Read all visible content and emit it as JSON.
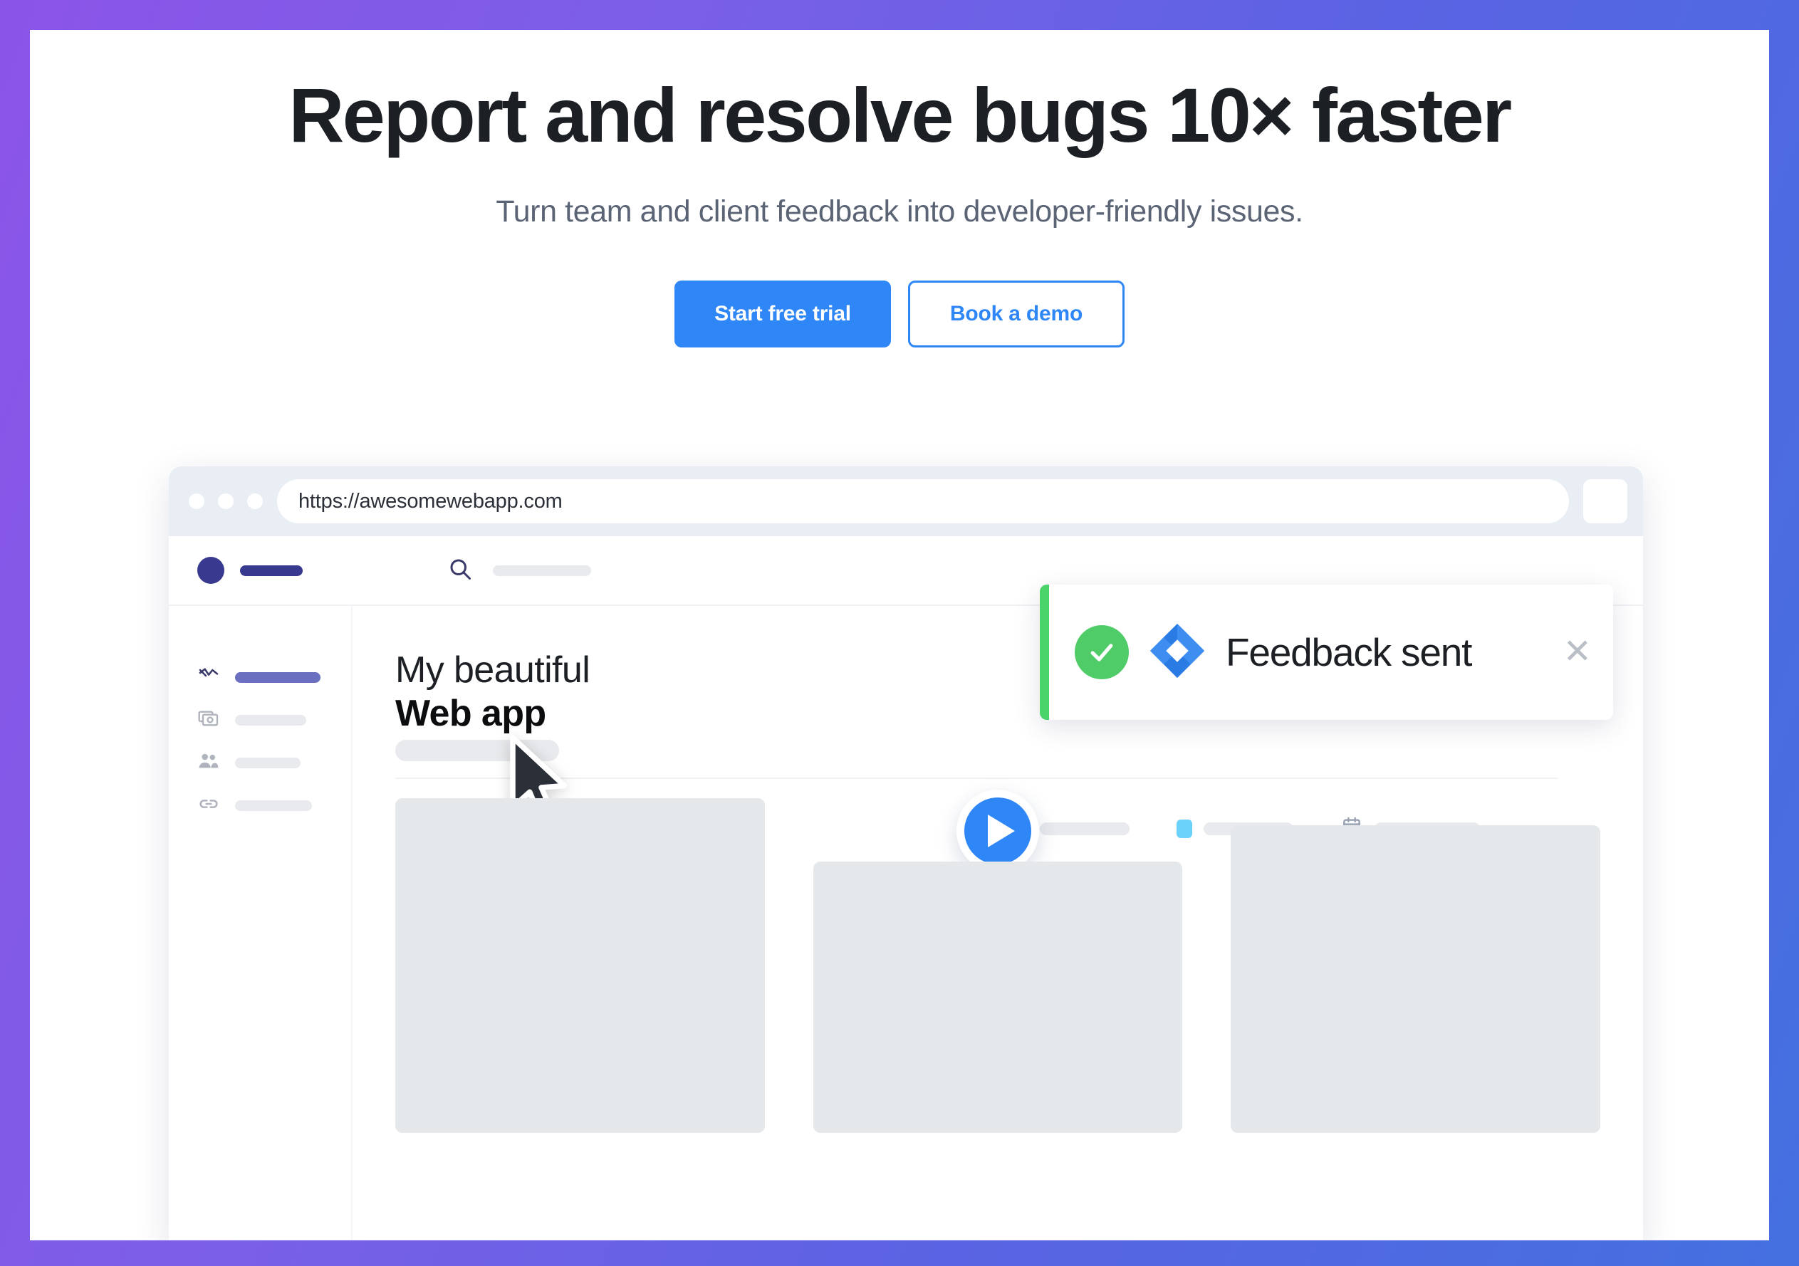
{
  "theme": {
    "gradient_start": "#8b54e8",
    "gradient_end": "#4470e0",
    "accent_blue": "#2f86f6",
    "success_green": "#4fcc68",
    "brand_indigo": "#373a8e",
    "toolbar_purple": "#7a0ae0",
    "toolbar_cyan": "#6ad2fb"
  },
  "hero": {
    "title": "Report and resolve bugs 10× faster",
    "subtitle": "Turn team and client feedback into developer-friendly issues.",
    "primary_cta": "Start free trial",
    "secondary_cta": "Book a demo"
  },
  "mockup": {
    "browser": {
      "url": "https://awesomewebapp.com",
      "traffic_lights": 3,
      "chrome_button_icon": "square-button-icon"
    },
    "app_header": {
      "logo_icon": "brand-dot-icon",
      "search_icon": "search-icon"
    },
    "sidebar": {
      "items": [
        {
          "icon": "trending-chart-icon",
          "active": true,
          "width": 120
        },
        {
          "icon": "money-bill-icon",
          "active": false,
          "width": 100
        },
        {
          "icon": "people-icon",
          "active": false,
          "width": 92
        },
        {
          "icon": "link-icon",
          "active": false,
          "width": 108
        }
      ]
    },
    "content": {
      "title_light": "My beautiful",
      "title_bold": "Web app",
      "toolbar": [
        {
          "icon": "purple-square-icon",
          "color": "#7a0ae0",
          "label_width": 126
        },
        {
          "icon": "cyan-square-icon",
          "color": "#6ad2fb",
          "label_width": 126
        },
        {
          "icon": "calendar-icon",
          "color": "#9aa3b2",
          "label_width": 148
        },
        {
          "icon": "more-horizontal-icon",
          "color": "#3c4250",
          "label_width": 0
        }
      ],
      "placeholder_cards": [
        {
          "height_pct": 100
        },
        {
          "height_pct": 81
        },
        {
          "height_pct": 92
        }
      ],
      "cursor_icon": "mouse-pointer-icon",
      "play_button_icon": "play-icon"
    },
    "toast": {
      "message": "Feedback sent",
      "status_icon": "check-circle-icon",
      "app_icon": "jira-diamond-icon",
      "close_icon": "close-icon",
      "accent_color": "#4ad46a"
    }
  }
}
